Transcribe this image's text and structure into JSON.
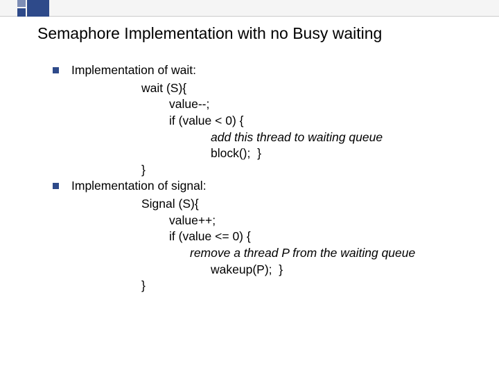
{
  "title": "Semaphore Implementation with no Busy waiting",
  "sections": [
    {
      "label": "Implementation of wait:",
      "lines": [
        {
          "text": "wait (S){",
          "cls": "ind1"
        },
        {
          "text": "value--;",
          "cls": "ind2"
        },
        {
          "text": "if (value < 0) {",
          "cls": "ind2"
        },
        {
          "text": "add this thread to waiting queue",
          "cls": "ind3 italic"
        },
        {
          "text": "block();  }",
          "cls": "ind3"
        },
        {
          "text": "}",
          "cls": "ind1"
        }
      ]
    },
    {
      "label": "Implementation of signal:",
      "lines": [
        {
          "text": "Signal (S){",
          "cls": "ind1"
        },
        {
          "text": "value++;",
          "cls": "ind2"
        },
        {
          "text": "if (value <= 0) {",
          "cls": "ind2"
        },
        {
          "text": "remove a thread P from the waiting queue",
          "cls": "ind3b italic"
        },
        {
          "text": "wakeup(P);  }",
          "cls": "ind3"
        },
        {
          "text": "}",
          "cls": "ind1"
        }
      ]
    }
  ]
}
